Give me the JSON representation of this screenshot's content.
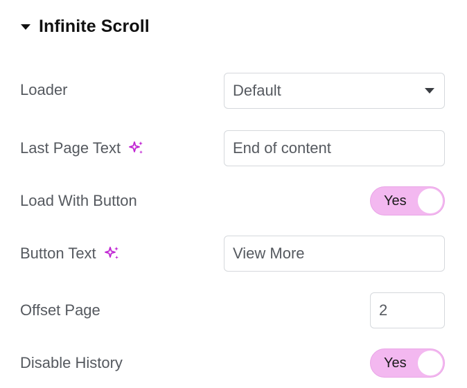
{
  "section": {
    "title": "Infinite Scroll"
  },
  "loader": {
    "label": "Loader",
    "value": "Default"
  },
  "last_page_text": {
    "label": "Last Page Text",
    "value": "End of content",
    "icon": "ai-sparkle-icon"
  },
  "load_with_button": {
    "label": "Load With Button",
    "toggle_label": "Yes",
    "enabled": true
  },
  "button_text": {
    "label": "Button Text",
    "value": "View More",
    "icon": "ai-sparkle-icon"
  },
  "offset_page": {
    "label": "Offset Page",
    "value": "2"
  },
  "disable_history": {
    "label": "Disable History",
    "toggle_label": "Yes",
    "enabled": true
  },
  "colors": {
    "accent_toggle": "#f3b8f0",
    "ai_icon": "#c026d3",
    "text": "#55595f",
    "border": "#d5d8dc"
  }
}
